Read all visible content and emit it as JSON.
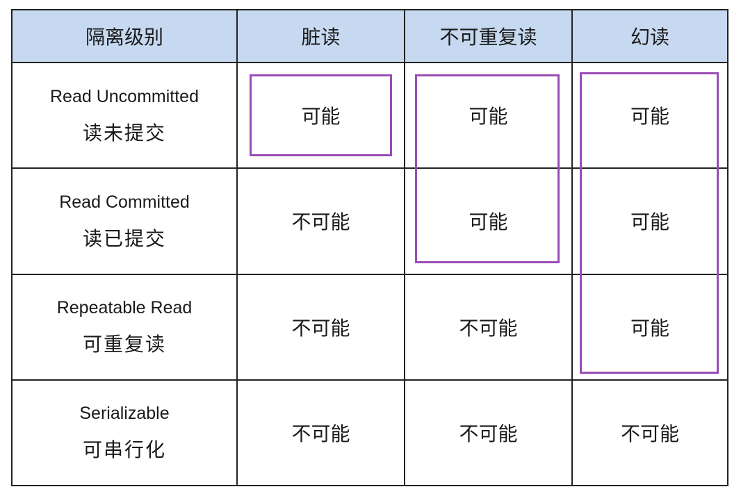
{
  "table": {
    "headers": [
      "隔离级别",
      "脏读",
      "不可重复读",
      "幻读"
    ],
    "header_bg": "#c6d9f0",
    "highlight_color": "#9a4cb6",
    "rows": [
      {
        "level_en": "Read Uncommitted",
        "level_zh": "读未提交",
        "dirty_read": "可能",
        "non_repeatable_read": "可能",
        "phantom_read": "可能"
      },
      {
        "level_en": "Read Committed",
        "level_zh": "读已提交",
        "dirty_read": "不可能",
        "non_repeatable_read": "可能",
        "phantom_read": "可能"
      },
      {
        "level_en": "Repeatable Read",
        "level_zh": "可重复读",
        "dirty_read": "不可能",
        "non_repeatable_read": "不可能",
        "phantom_read": "可能"
      },
      {
        "level_en": "Serializable",
        "level_zh": "可串行化",
        "dirty_read": "不可能",
        "non_repeatable_read": "不可能",
        "phantom_read": "不可能"
      }
    ]
  }
}
